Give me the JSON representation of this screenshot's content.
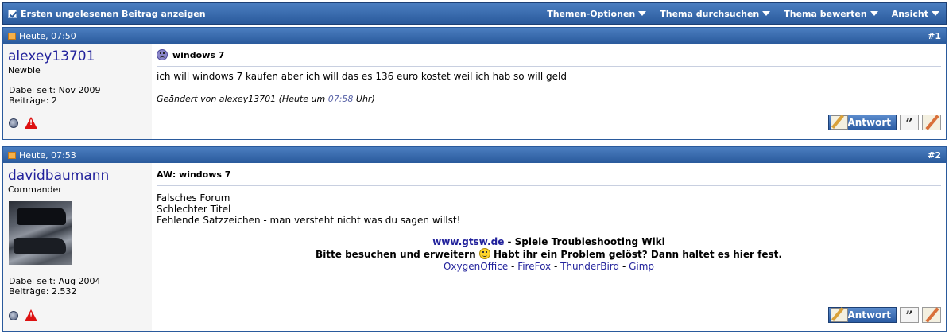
{
  "toolbar": {
    "first_unread": "Ersten ungelesenen Beitrag anzeigen",
    "menus": [
      "Themen-Optionen",
      "Thema durchsuchen",
      "Thema bewerten",
      "Ansicht"
    ]
  },
  "posts": [
    {
      "date": "Heute, 07:50",
      "number": "#1",
      "username": "alexey13701",
      "usertitle": "Newbie",
      "joined": "Dabei seit: Nov 2009",
      "posts_count": "Beiträge: 2",
      "title": "windows 7",
      "text": "ich will windows 7 kaufen aber ich will das es 136 euro kostet weil ich hab so will geld",
      "edited_prefix": "Geändert von alexey13701 (Heute um ",
      "edited_time": "07:58",
      "edited_suffix": " Uhr)",
      "reply_label": "Antwort"
    },
    {
      "date": "Heute, 07:53",
      "number": "#2",
      "username": "davidbaumann",
      "usertitle": "Commander",
      "joined": "Dabei seit: Aug 2004",
      "posts_count": "Beiträge: 2.532",
      "title": "AW: windows 7",
      "lines": [
        "Falsches Forum",
        "Schlechter Titel",
        "Fehlende Satzzeichen - man versteht nicht was du sagen willst!"
      ],
      "sig": {
        "site_link": "www.gtsw.de",
        "site_desc": " - Spiele Troubleshooting Wiki",
        "line2a": "Bitte besuchen und erweitern ",
        "line2b": " Habt ihr ein Problem gelöst? Dann haltet es hier fest.",
        "links": [
          "OxygenOffice",
          "FireFox",
          "ThunderBird",
          "Gimp"
        ],
        "sep": " - "
      },
      "reply_label": "Antwort"
    }
  ]
}
